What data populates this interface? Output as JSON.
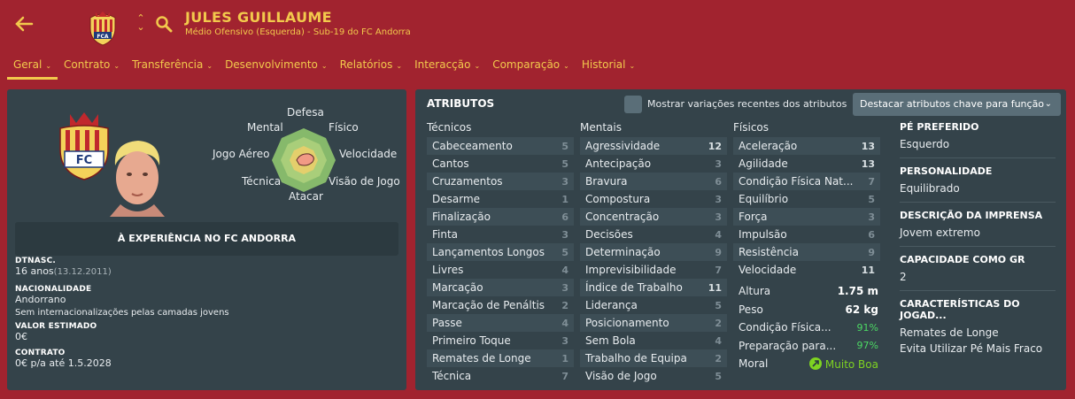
{
  "header": {
    "name": "JULES GUILLAUME",
    "subtitle": "Médio Ofensivo (Esquerda) - Sub-19 do FC Andorra"
  },
  "tabs": [
    {
      "label": "Geral"
    },
    {
      "label": "Contrato"
    },
    {
      "label": "Transferência"
    },
    {
      "label": "Desenvolvimento"
    },
    {
      "label": "Relatórios"
    },
    {
      "label": "Interacção"
    },
    {
      "label": "Comparação"
    },
    {
      "label": "Historial"
    }
  ],
  "radar": {
    "defesa": "Defesa",
    "mental": "Mental",
    "fisico": "Físico",
    "jogo_aereo": "Jogo Aéreo",
    "velocidade": "Velocidade",
    "tecnica": "Técnica",
    "visao": "Visão de Jogo",
    "atacar": "Atacar"
  },
  "experience": "À EXPERIÊNCIA NO FC ANDORRA",
  "info": {
    "dob_label": "DTNASC.",
    "dob_age": "16 anos",
    "dob_date": "(13.12.2011)",
    "nat_label": "NACIONALIDADE",
    "nat_value": "Andorrano",
    "nat_caps": "Sem internacionalizações pelas camadas jovens",
    "value_label": "VALOR ESTIMADO",
    "value": "0€",
    "contract_label": "CONTRATO",
    "contract": "0€ p/a até 1.5.2028"
  },
  "attributes": {
    "title": "ATRIBUTOS",
    "checkbox_label": "Mostrar variações recentes dos atributos",
    "dropdown": "Destacar atributos chave para função",
    "tecnicos_label": "Técnicos",
    "mentais_label": "Mentais",
    "fisicos_label": "Físicos",
    "tecnicos": [
      {
        "n": "Cabeceamento",
        "v": "5"
      },
      {
        "n": "Cantos",
        "v": "5"
      },
      {
        "n": "Cruzamentos",
        "v": "3"
      },
      {
        "n": "Desarme",
        "v": "1"
      },
      {
        "n": "Finalização",
        "v": "6"
      },
      {
        "n": "Finta",
        "v": "3"
      },
      {
        "n": "Lançamentos Longos",
        "v": "5"
      },
      {
        "n": "Livres",
        "v": "4"
      },
      {
        "n": "Marcação",
        "v": "3"
      },
      {
        "n": "Marcação de Penáltis",
        "v": "2"
      },
      {
        "n": "Passe",
        "v": "4"
      },
      {
        "n": "Primeiro Toque",
        "v": "3"
      },
      {
        "n": "Remates de Longe",
        "v": "1"
      },
      {
        "n": "Técnica",
        "v": "7"
      }
    ],
    "mentais": [
      {
        "n": "Agressividade",
        "v": "12"
      },
      {
        "n": "Antecipação",
        "v": "3"
      },
      {
        "n": "Bravura",
        "v": "6"
      },
      {
        "n": "Compostura",
        "v": "3"
      },
      {
        "n": "Concentração",
        "v": "3"
      },
      {
        "n": "Decisões",
        "v": "4"
      },
      {
        "n": "Determinação",
        "v": "9"
      },
      {
        "n": "Imprevisibilidade",
        "v": "7"
      },
      {
        "n": "Índice de Trabalho",
        "v": "11"
      },
      {
        "n": "Liderança",
        "v": "5"
      },
      {
        "n": "Posicionamento",
        "v": "2"
      },
      {
        "n": "Sem Bola",
        "v": "4"
      },
      {
        "n": "Trabalho de Equipa",
        "v": "2"
      },
      {
        "n": "Visão de Jogo",
        "v": "5"
      }
    ],
    "fisicos": [
      {
        "n": "Aceleração",
        "v": "13"
      },
      {
        "n": "Agilidade",
        "v": "13"
      },
      {
        "n": "Condição Física Nat...",
        "v": "7"
      },
      {
        "n": "Equilíbrio",
        "v": "5"
      },
      {
        "n": "Força",
        "v": "3"
      },
      {
        "n": "Impulsão",
        "v": "6"
      },
      {
        "n": "Resistência",
        "v": "9"
      },
      {
        "n": "Velocidade",
        "v": "11"
      }
    ],
    "altura_label": "Altura",
    "altura": "1.75 m",
    "peso_label": "Peso",
    "peso": "62 kg",
    "cond_label": "Condição Física...",
    "cond": "91%",
    "prep_label": "Preparação para...",
    "prep": "97%",
    "moral_label": "Moral",
    "moral": "Muito Boa"
  },
  "profile": {
    "pe_label": "PÉ PREFERIDO",
    "pe": "Esquerdo",
    "pers_label": "PERSONALIDADE",
    "pers": "Equilibrado",
    "imprensa_label": "DESCRIÇÃO DA IMPRENSA",
    "imprensa": "Jovem extremo",
    "gr_label": "CAPACIDADE COMO GR",
    "gr": "2",
    "carac_label": "CARACTERÍSTICAS DO JOGAD...",
    "carac1": "Remates de Longe",
    "carac2": "Evita Utilizar Pé Mais Fraco"
  },
  "colors": {
    "header": "#a1232f",
    "accent": "#f2c94c",
    "panel": "#34434a",
    "green": "#4cd964"
  }
}
